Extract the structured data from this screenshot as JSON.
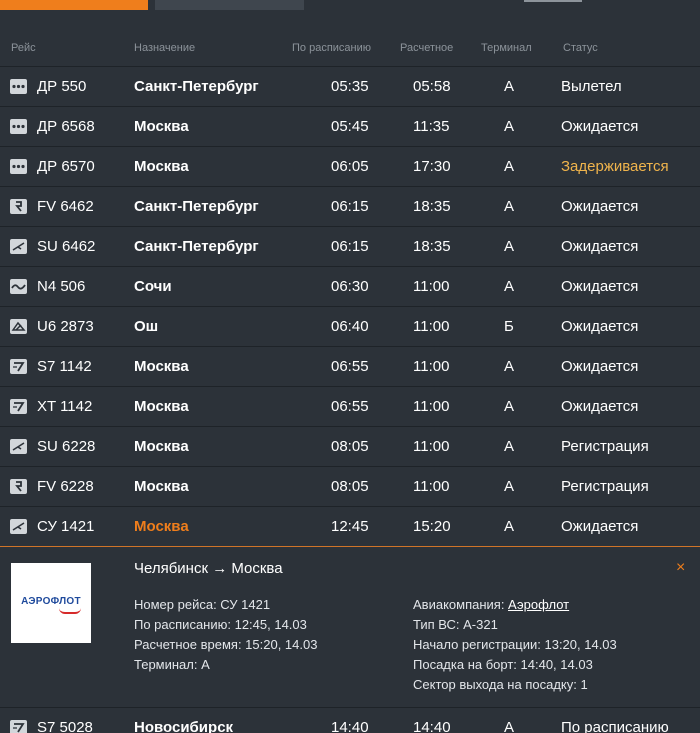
{
  "header": {
    "flight": "Рейс",
    "destination": "Назначение",
    "scheduled": "По расписанию",
    "estimated": "Расчетное",
    "terminal": "Терминал",
    "status": "Статус"
  },
  "colors": {
    "accent": "#ef7e1c",
    "delayed": "#f0b44c",
    "background": "#2c3239"
  },
  "flights": [
    {
      "icon": "dots-airline-icon",
      "flight": "ДР 550",
      "dest": "Санкт-Петербург",
      "sched": "05:35",
      "est": "05:58",
      "term": "А",
      "status": "Вылетел"
    },
    {
      "icon": "dots-airline-icon",
      "flight": "ДР 6568",
      "dest": "Москва",
      "sched": "05:45",
      "est": "11:35",
      "term": "А",
      "status": "Ожидается"
    },
    {
      "icon": "dots-airline-icon",
      "flight": "ДР 6570",
      "dest": "Москва",
      "sched": "06:05",
      "est": "17:30",
      "term": "А",
      "status": "Задерживается"
    },
    {
      "icon": "rossiya-airline-icon",
      "flight": "FV 6462",
      "dest": "Санкт-Петербург",
      "sched": "06:15",
      "est": "18:35",
      "term": "А",
      "status": "Ожидается"
    },
    {
      "icon": "aeroflot-airline-icon",
      "flight": "SU 6462",
      "dest": "Санкт-Петербург",
      "sched": "06:15",
      "est": "18:35",
      "term": "А",
      "status": "Ожидается"
    },
    {
      "icon": "nordwind-airline-icon",
      "flight": "N4 506",
      "dest": "Сочи",
      "sched": "06:30",
      "est": "11:00",
      "term": "А",
      "status": "Ожидается"
    },
    {
      "icon": "uralairlines-airline-icon",
      "flight": "U6 2873",
      "dest": "Ош",
      "sched": "06:40",
      "est": "11:00",
      "term": "Б",
      "status": "Ожидается"
    },
    {
      "icon": "s7-airline-icon",
      "flight": "S7 1142",
      "dest": "Москва",
      "sched": "06:55",
      "est": "11:00",
      "term": "А",
      "status": "Ожидается"
    },
    {
      "icon": "s7-airline-icon",
      "flight": "XT 1142",
      "dest": "Москва",
      "sched": "06:55",
      "est": "11:00",
      "term": "А",
      "status": "Ожидается"
    },
    {
      "icon": "aeroflot-airline-icon",
      "flight": "SU 6228",
      "dest": "Москва",
      "sched": "08:05",
      "est": "11:00",
      "term": "А",
      "status": "Регистрация"
    },
    {
      "icon": "rossiya-airline-icon",
      "flight": "FV 6228",
      "dest": "Москва",
      "sched": "08:05",
      "est": "11:00",
      "term": "А",
      "status": "Регистрация"
    },
    {
      "icon": "aeroflot-airline-icon",
      "flight": "СУ 1421",
      "dest": "Москва",
      "sched": "12:45",
      "est": "15:20",
      "term": "А",
      "status": "Ожидается"
    }
  ],
  "detail": {
    "route": "Челябинск → Москва",
    "close_icon": "×",
    "logo_text": "АЭРОФЛОТ",
    "flight_no": "Номер рейса: СУ 1421",
    "scheduled": "По расписанию: 12:45, 14.03",
    "estimated": "Расчетное время: 15:20, 14.03",
    "terminal": "Терминал: А",
    "airline_label": "Авиакомпания: ",
    "airline_name": "Аэрофлот",
    "aircraft": "Тип ВС: А-321",
    "checkin": "Начало регистрации: 13:20, 14.03",
    "boarding": "Посадка на борт: 14:40, 14.03",
    "gate": "Сектор выхода на посадку: 1"
  },
  "last_flight": {
    "icon": "s7-airline-icon",
    "flight": "S7 5028",
    "dest": "Новосибирск",
    "sched": "14:40",
    "est": "14:40",
    "term": "А",
    "status": "По расписанию"
  }
}
